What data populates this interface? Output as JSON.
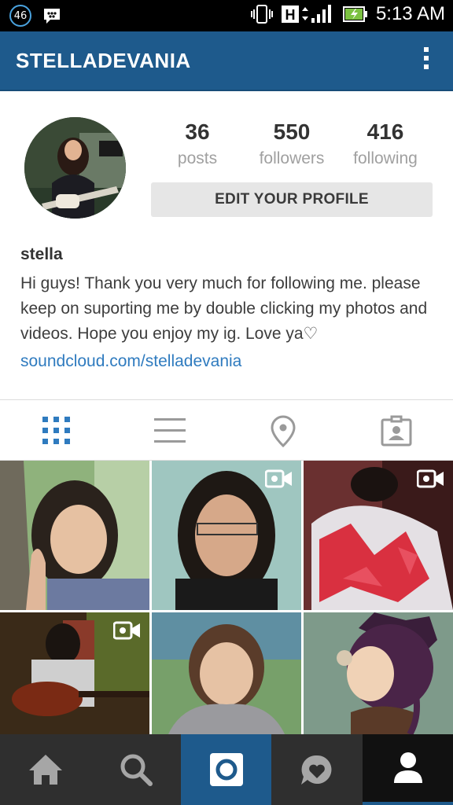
{
  "status_bar": {
    "notification_count": "46",
    "network_type": "H",
    "time": "5:13 AM"
  },
  "app_bar": {
    "title": "STELLADEVANIA"
  },
  "profile": {
    "stats": [
      {
        "value": "36",
        "label": "posts"
      },
      {
        "value": "550",
        "label": "followers"
      },
      {
        "value": "416",
        "label": "following"
      }
    ],
    "edit_button_label": "EDIT YOUR PROFILE",
    "name": "stella",
    "bio": "Hi guys! Thank you very much for following me. please keep on suporting me by double clicking my photos and videos. Hope you enjoy my ig. Love ya♡",
    "link": "soundcloud.com/stelladevania"
  },
  "tabs": [
    {
      "icon": "grid-icon",
      "active": true
    },
    {
      "icon": "list-icon",
      "active": false
    },
    {
      "icon": "location-pin-icon",
      "active": false
    },
    {
      "icon": "tagged-photos-icon",
      "active": false
    }
  ],
  "grid": [
    {
      "kind": "photo",
      "video": false
    },
    {
      "kind": "video",
      "video": true
    },
    {
      "kind": "video",
      "video": true
    },
    {
      "kind": "video",
      "video": true
    },
    {
      "kind": "photo",
      "video": false
    },
    {
      "kind": "photo",
      "video": false
    }
  ],
  "bottom_nav": [
    {
      "icon": "home-icon",
      "active": false
    },
    {
      "icon": "search-icon",
      "active": false
    },
    {
      "icon": "camera-icon",
      "active": false
    },
    {
      "icon": "activity-heart-icon",
      "active": false
    },
    {
      "icon": "profile-icon",
      "active": true
    }
  ],
  "colors": {
    "app_bar": "#1e5a8c",
    "link": "#2f7bbf",
    "tab_active": "#2f7bbf",
    "bottom_nav": "#2f2f2f",
    "camera_tab": "#1e5a8c",
    "profile_tab": "#111111"
  }
}
